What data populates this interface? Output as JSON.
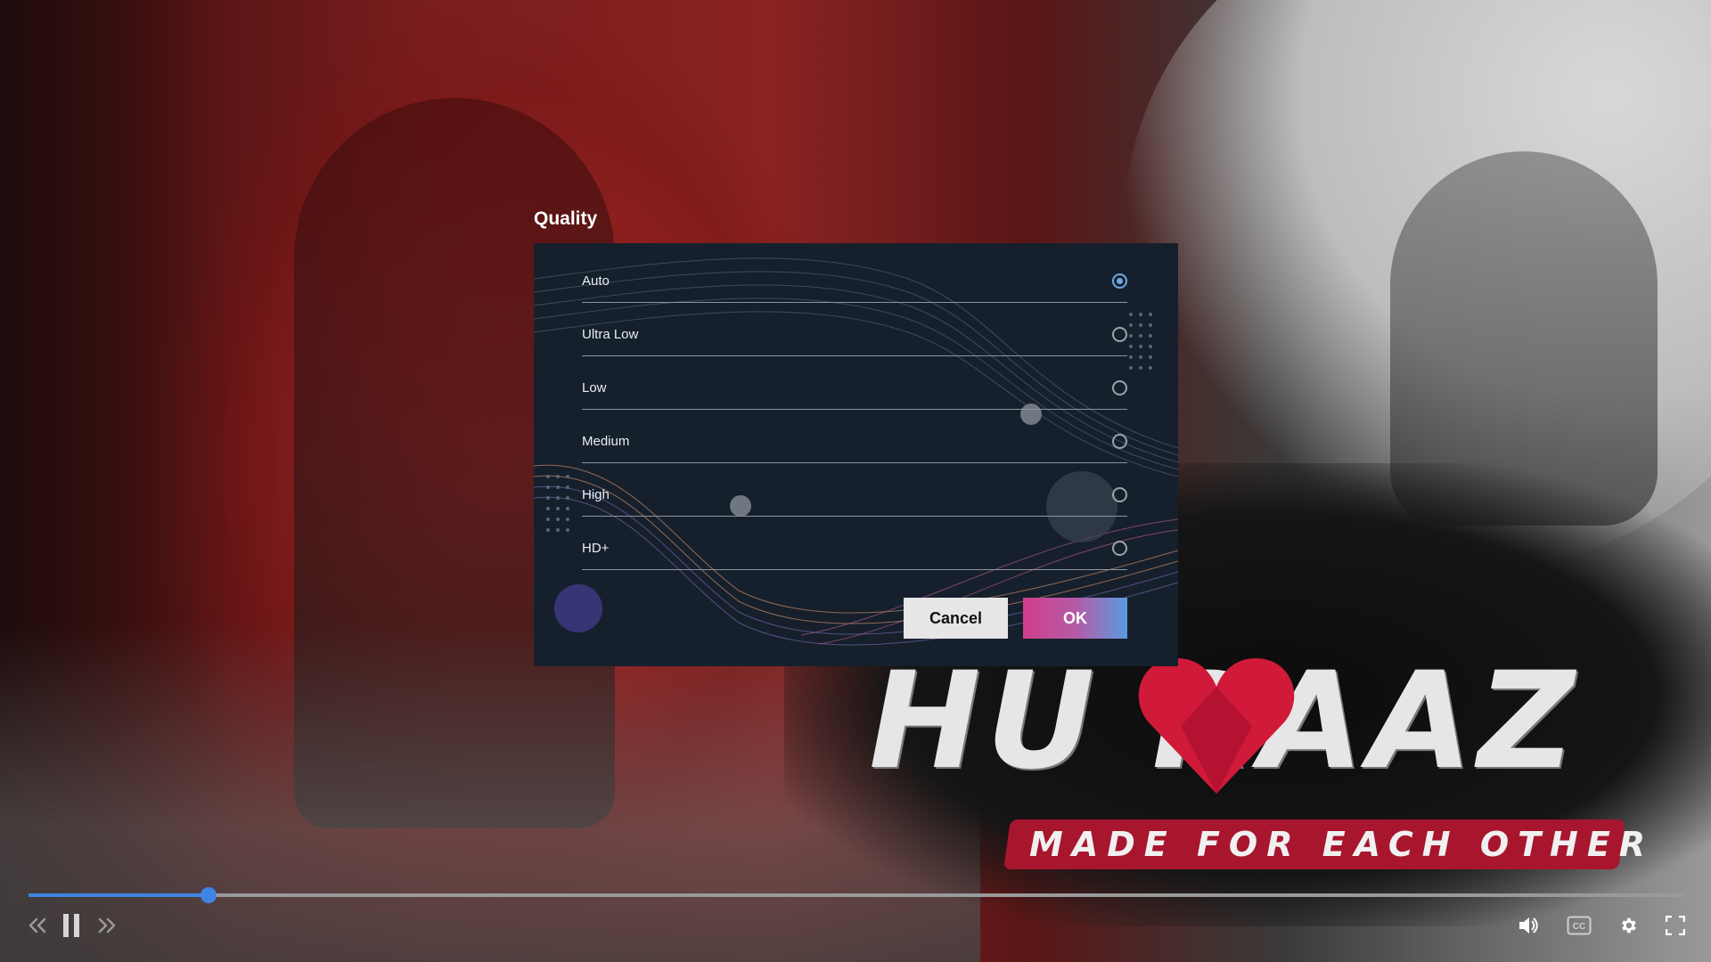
{
  "background": {
    "logo_title": "HU  RAAZ",
    "logo_subtitle": "MADE FOR EACH OTHER"
  },
  "dialog": {
    "title": "Quality",
    "options": [
      {
        "label": "Auto",
        "selected": true
      },
      {
        "label": "Ultra Low",
        "selected": false
      },
      {
        "label": "Low",
        "selected": false
      },
      {
        "label": "Medium",
        "selected": false
      },
      {
        "label": "High",
        "selected": false
      },
      {
        "label": "HD+",
        "selected": false
      }
    ],
    "cancel_label": "Cancel",
    "ok_label": "OK"
  },
  "player": {
    "progress_fraction": 0.109,
    "icons": {
      "rewind": "rewind-icon",
      "pause": "pause-icon",
      "forward": "fast-forward-icon",
      "volume": "volume-icon",
      "captions": "closed-captions-icon",
      "settings": "settings-gear-icon",
      "fullscreen": "fullscreen-icon"
    }
  },
  "colors": {
    "accent": "#3f84e5",
    "dialog_bg": "#16202c",
    "ok_gradient_start": "#cf3e8c",
    "ok_gradient_end": "#5a9be0",
    "logo_banner": "#a8162e"
  }
}
